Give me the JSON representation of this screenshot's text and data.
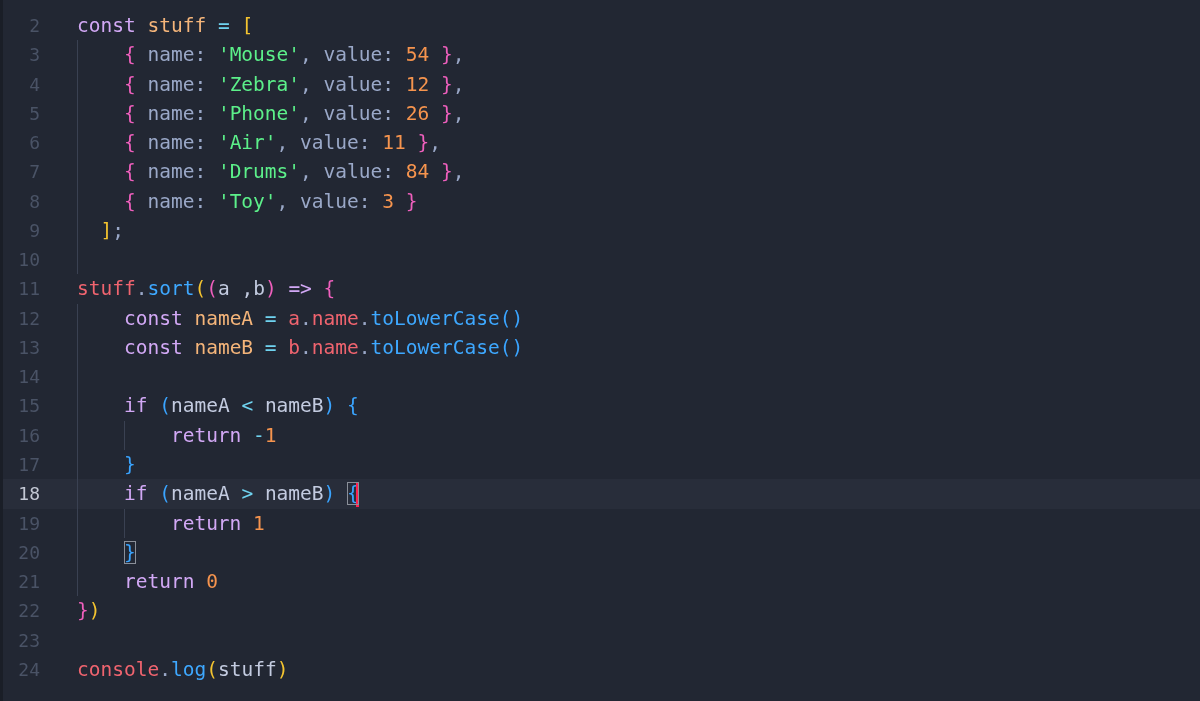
{
  "editor": {
    "lines": [
      {
        "number": "2",
        "current": false,
        "tokens": [
          {
            "text": "const ",
            "kind": "keyword"
          },
          {
            "text": "stuff",
            "kind": "decl"
          },
          {
            "text": " = ",
            "kind": "op"
          },
          {
            "text": "[",
            "kind": "bracket1"
          }
        ]
      },
      {
        "number": "3",
        "current": false,
        "guides": [
          {
            "kind": "tab"
          }
        ],
        "tokens": [
          {
            "text": "{",
            "kind": "bracket2"
          },
          {
            "text": " name: ",
            "kind": "prop"
          },
          {
            "text": "'Mouse'",
            "kind": "string"
          },
          {
            "text": ", value: ",
            "kind": "prop"
          },
          {
            "text": "54 ",
            "kind": "number"
          },
          {
            "text": "}",
            "kind": "bracket2"
          },
          {
            "text": ",",
            "kind": "prop"
          }
        ]
      },
      {
        "number": "4",
        "current": false,
        "guides": [
          {
            "kind": "tab"
          }
        ],
        "tokens": [
          {
            "text": "{",
            "kind": "bracket2"
          },
          {
            "text": " name: ",
            "kind": "prop"
          },
          {
            "text": "'Zebra'",
            "kind": "string"
          },
          {
            "text": ", value: ",
            "kind": "prop"
          },
          {
            "text": "12 ",
            "kind": "number"
          },
          {
            "text": "}",
            "kind": "bracket2"
          },
          {
            "text": ",",
            "kind": "prop"
          }
        ]
      },
      {
        "number": "5",
        "current": false,
        "guides": [
          {
            "kind": "tab"
          }
        ],
        "tokens": [
          {
            "text": "{",
            "kind": "bracket2"
          },
          {
            "text": " name: ",
            "kind": "prop"
          },
          {
            "text": "'Phone'",
            "kind": "string"
          },
          {
            "text": ", value: ",
            "kind": "prop"
          },
          {
            "text": "26 ",
            "kind": "number"
          },
          {
            "text": "}",
            "kind": "bracket2"
          },
          {
            "text": ",",
            "kind": "prop"
          }
        ]
      },
      {
        "number": "6",
        "current": false,
        "guides": [
          {
            "kind": "tab"
          }
        ],
        "tokens": [
          {
            "text": "{",
            "kind": "bracket2"
          },
          {
            "text": " name: ",
            "kind": "prop"
          },
          {
            "text": "'Air'",
            "kind": "string"
          },
          {
            "text": ", value: ",
            "kind": "prop"
          },
          {
            "text": "11 ",
            "kind": "number"
          },
          {
            "text": "}",
            "kind": "bracket2"
          },
          {
            "text": ",",
            "kind": "prop"
          }
        ]
      },
      {
        "number": "7",
        "current": false,
        "guides": [
          {
            "kind": "tab"
          }
        ],
        "tokens": [
          {
            "text": "{",
            "kind": "bracket2"
          },
          {
            "text": " name: ",
            "kind": "prop"
          },
          {
            "text": "'Drums'",
            "kind": "string"
          },
          {
            "text": ", value: ",
            "kind": "prop"
          },
          {
            "text": "84 ",
            "kind": "number"
          },
          {
            "text": "}",
            "kind": "bracket2"
          },
          {
            "text": ",",
            "kind": "prop"
          }
        ]
      },
      {
        "number": "8",
        "current": false,
        "guides": [
          {
            "kind": "tab"
          }
        ],
        "tokens": [
          {
            "text": "{",
            "kind": "bracket2"
          },
          {
            "text": " name: ",
            "kind": "prop"
          },
          {
            "text": "'Toy'",
            "kind": "string"
          },
          {
            "text": ", value: ",
            "kind": "prop"
          },
          {
            "text": "3 ",
            "kind": "number"
          },
          {
            "text": "}",
            "kind": "bracket2"
          }
        ]
      },
      {
        "number": "9",
        "current": false,
        "guides": [
          {
            "kind": "half"
          }
        ],
        "tokens": [
          {
            "text": "]",
            "kind": "bracket1"
          },
          {
            "text": ";",
            "kind": "prop"
          }
        ]
      },
      {
        "number": "10",
        "current": false,
        "guides": [
          {
            "kind": "tab"
          }
        ]
      },
      {
        "number": "11",
        "current": false,
        "tokens": [
          {
            "text": "stuff",
            "kind": "object"
          },
          {
            "text": ".",
            "kind": "prop"
          },
          {
            "text": "sort",
            "kind": "func"
          },
          {
            "text": "(",
            "kind": "bracket1"
          },
          {
            "text": "(",
            "kind": "bracket2"
          },
          {
            "text": "a ,b",
            "kind": "ident"
          },
          {
            "text": ") ",
            "kind": "bracket2"
          },
          {
            "text": "=> ",
            "kind": "keyword"
          },
          {
            "text": "{",
            "kind": "bracket2"
          }
        ]
      },
      {
        "number": "12",
        "current": false,
        "guides": [
          {
            "kind": "tab"
          }
        ],
        "tokens": [
          {
            "text": "const ",
            "kind": "keyword"
          },
          {
            "text": "nameA",
            "kind": "decl"
          },
          {
            "text": " = ",
            "kind": "op"
          },
          {
            "text": "a",
            "kind": "object"
          },
          {
            "text": ".",
            "kind": "prop"
          },
          {
            "text": "name",
            "kind": "object"
          },
          {
            "text": ".",
            "kind": "prop"
          },
          {
            "text": "toLowerCase",
            "kind": "func"
          },
          {
            "text": "()",
            "kind": "bracket3"
          }
        ]
      },
      {
        "number": "13",
        "current": false,
        "guides": [
          {
            "kind": "tab"
          }
        ],
        "tokens": [
          {
            "text": "const ",
            "kind": "keyword"
          },
          {
            "text": "nameB",
            "kind": "decl"
          },
          {
            "text": " = ",
            "kind": "op"
          },
          {
            "text": "b",
            "kind": "object"
          },
          {
            "text": ".",
            "kind": "prop"
          },
          {
            "text": "name",
            "kind": "object"
          },
          {
            "text": ".",
            "kind": "prop"
          },
          {
            "text": "toLowerCase",
            "kind": "func"
          },
          {
            "text": "()",
            "kind": "bracket3"
          }
        ]
      },
      {
        "number": "14",
        "current": false,
        "guides": [
          {
            "kind": "tab"
          }
        ]
      },
      {
        "number": "15",
        "current": false,
        "guides": [
          {
            "kind": "tab"
          }
        ],
        "tokens": [
          {
            "text": "if ",
            "kind": "keyword"
          },
          {
            "text": "(",
            "kind": "bracket3"
          },
          {
            "text": "nameA",
            "kind": "ident"
          },
          {
            "text": " < ",
            "kind": "op"
          },
          {
            "text": "nameB",
            "kind": "ident"
          },
          {
            "text": ") {",
            "kind": "bracket3"
          }
        ]
      },
      {
        "number": "16",
        "current": false,
        "guides": [
          {
            "kind": "tab"
          },
          {
            "kind": "tab"
          }
        ],
        "tokens": [
          {
            "text": "return ",
            "kind": "keyword"
          },
          {
            "text": "-",
            "kind": "op"
          },
          {
            "text": "1",
            "kind": "number"
          }
        ]
      },
      {
        "number": "17",
        "current": false,
        "guides": [
          {
            "kind": "tab"
          }
        ],
        "tokens": [
          {
            "text": "}",
            "kind": "bracket3"
          }
        ]
      },
      {
        "number": "18",
        "current": true,
        "guides": [
          {
            "kind": "tab"
          }
        ],
        "tokens": [
          {
            "text": "if ",
            "kind": "keyword"
          },
          {
            "text": "(",
            "kind": "bracket3"
          },
          {
            "text": "nameA",
            "kind": "ident"
          },
          {
            "text": " > ",
            "kind": "op"
          },
          {
            "text": "nameB",
            "kind": "ident"
          },
          {
            "text": ") ",
            "kind": "bracket3"
          },
          {
            "text": "{",
            "kind": "match"
          }
        ]
      },
      {
        "number": "19",
        "current": false,
        "guides": [
          {
            "kind": "tab"
          },
          {
            "kind": "tab"
          }
        ],
        "tokens": [
          {
            "text": "return ",
            "kind": "keyword"
          },
          {
            "text": "1",
            "kind": "number"
          }
        ]
      },
      {
        "number": "20",
        "current": false,
        "guides": [
          {
            "kind": "tab"
          }
        ],
        "tokens": [
          {
            "text": "}",
            "kind": "match"
          }
        ]
      },
      {
        "number": "21",
        "current": false,
        "guides": [
          {
            "kind": "tab"
          }
        ],
        "tokens": [
          {
            "text": "return ",
            "kind": "keyword"
          },
          {
            "text": "0",
            "kind": "number"
          }
        ]
      },
      {
        "number": "22",
        "current": false,
        "tokens": [
          {
            "text": "}",
            "kind": "bracket2"
          },
          {
            "text": ")",
            "kind": "bracket1"
          }
        ]
      },
      {
        "number": "23",
        "current": false
      },
      {
        "number": "24",
        "current": false,
        "tokens": [
          {
            "text": "console",
            "kind": "object"
          },
          {
            "text": ".",
            "kind": "prop"
          },
          {
            "text": "log",
            "kind": "func"
          },
          {
            "text": "(",
            "kind": "bracket1"
          },
          {
            "text": "stuff",
            "kind": "ident"
          },
          {
            "text": ")",
            "kind": "bracket1"
          }
        ]
      }
    ]
  }
}
